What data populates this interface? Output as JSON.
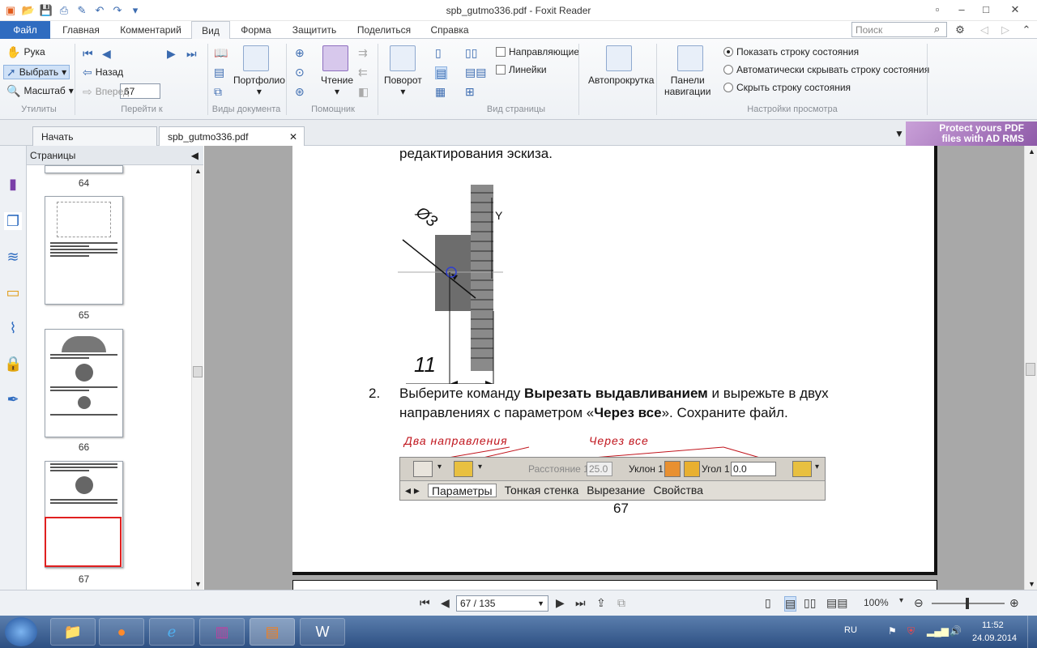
{
  "window": {
    "title": "spb_gutmo336.pdf - Foxit Reader"
  },
  "tabs": [
    "Файл",
    "Главная",
    "Комментарий",
    "Вид",
    "Форма",
    "Защитить",
    "Поделиться",
    "Справка"
  ],
  "search": {
    "placeholder": "Поиск"
  },
  "ribbon": {
    "tools": {
      "hand": "Рука",
      "select": "Выбрать",
      "zoom": "Масштаб",
      "label": "Утилиты"
    },
    "goto": {
      "page": "67",
      "back": "Назад",
      "forward": "Вперед",
      "label": "Перейти к"
    },
    "docviews": {
      "portfolio": "Портфолио",
      "label": "Виды документа"
    },
    "assistant": {
      "reading": "Чтение",
      "label": "Помощник"
    },
    "pageview": {
      "rotate": "Поворот",
      "guides": "Направляющие",
      "rulers": "Линейки",
      "label": "Вид страницы"
    },
    "autoscroll": "Автопрокрутка",
    "navpanels": {
      "line1": "Панели",
      "line2": "навигации"
    },
    "viewsettings": {
      "opt1": "Показать строку состояния",
      "opt2": "Автоматически скрывать строку состояния",
      "opt3": "Скрыть строку состояния",
      "label": "Настройки просмотра"
    }
  },
  "doctabs": {
    "start": "Начать",
    "file": "spb_gutmo336.pdf"
  },
  "ad": {
    "line1": "Protect yours PDF",
    "line2": "files with AD RMS"
  },
  "pagespanel": {
    "title": "Страницы",
    "thumbs": [
      "64",
      "65",
      "66",
      "67"
    ]
  },
  "document": {
    "top_text": "редактирования эскиза.",
    "dim_diameter": "Ø3",
    "dim_length": "11",
    "axis_y": "Y",
    "item_num": "2.",
    "item_line1_a": "Выберите команду ",
    "item_line1_b": "Вырезать выдавливанием",
    "item_line1_c": " и вырежьте в двух",
    "item_line2_a": "направлениях с параметром «",
    "item_line2_b": "Через все",
    "item_line2_c": "». Сохраните файл.",
    "label_two_dir": "Два направления",
    "label_through": "Через все",
    "toolbar": {
      "distance": "Расстояние 1",
      "distance_val": "25.0",
      "slope": "Уклон 1",
      "angle": "Угол 1",
      "angle_val": "0.0",
      "tabs": [
        "Параметры",
        "Тонкая стенка",
        "Вырезание",
        "Свойства"
      ]
    },
    "page_number": "67"
  },
  "status": {
    "page": "67 / 135",
    "zoom": "100%"
  },
  "tray": {
    "lang": "RU",
    "time": "11:52",
    "date": "24.09.2014"
  }
}
